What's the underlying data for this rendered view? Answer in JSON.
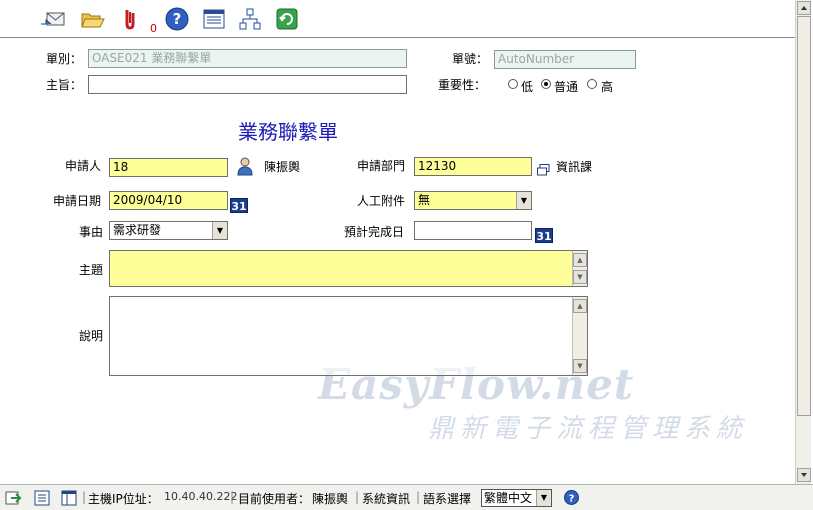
{
  "toolbar": {
    "buttons": [
      {
        "icon": "send-mail-icon"
      },
      {
        "icon": "open-folder-icon"
      },
      {
        "icon": "attachment-icon",
        "badge": "0"
      },
      {
        "icon": "help-icon"
      },
      {
        "icon": "form-list-icon"
      },
      {
        "icon": "flowchart-icon"
      },
      {
        "icon": "refresh-icon"
      }
    ]
  },
  "header": {
    "form_type_label": "單別：",
    "form_type_value": "OASE021 業務聯繫單",
    "form_no_label": "單號：",
    "form_no_value": "AutoNumber",
    "subject_label": "主旨：",
    "subject_value": "",
    "priority_label": "重要性：",
    "priority_options": [
      "低",
      "普通",
      "高"
    ],
    "priority_selected": "普通"
  },
  "form": {
    "title": "業務聯繫單",
    "applicant_label": "申請人",
    "applicant_id": "18",
    "applicant_name": "陳振輿",
    "dept_label": "申請部門",
    "dept_id": "12130",
    "dept_name": "資訊課",
    "date_label": "申請日期",
    "date_value": "2009/04/10",
    "calendar_text": "31",
    "attachment_label": "人工附件",
    "attachment_value": "無",
    "reason_label": "事由",
    "reason_value": "需求研發",
    "due_label": "預計完成日",
    "due_value": "",
    "topic_label": "主題",
    "topic_value": "",
    "desc_label": "說明",
    "desc_value": ""
  },
  "watermark": {
    "line1": "EasyFlow.net",
    "line2": "鼎新電子流程管理系統"
  },
  "status": {
    "host_ip_label": "主機IP位址：",
    "host_ip": "10.40.40.222",
    "user_label": "目前使用者：",
    "user_name": "陳振輿",
    "sys_info": "系統資訊",
    "lang_label": "語系選擇",
    "lang_value": "繁體中文"
  },
  "colors": {
    "title": "#1c1cb8",
    "required_field": "#ffff99",
    "calendar": "#1c3c8c",
    "readonly_field": "#eaf4f0"
  }
}
